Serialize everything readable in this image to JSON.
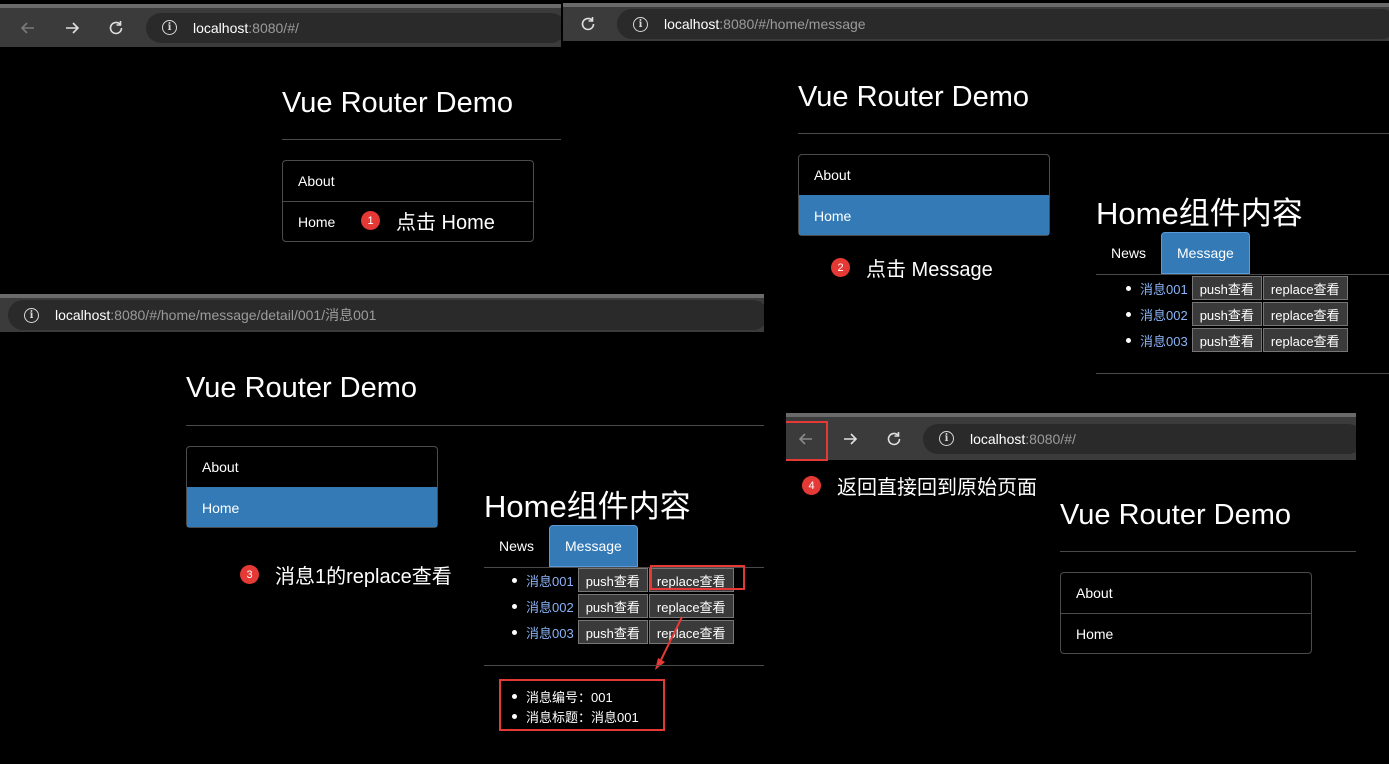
{
  "panel1": {
    "url_host": "localhost",
    "url_path": ":8080/#/",
    "title": "Vue Router Demo",
    "nav": [
      "About",
      "Home"
    ],
    "step_num": "1",
    "step_text": "点击 Home"
  },
  "panel2": {
    "url_host": "localhost",
    "url_path": ":8080/#/home/message",
    "title": "Vue Router Demo",
    "nav": [
      "About",
      "Home"
    ],
    "active_nav": "Home",
    "step_num": "2",
    "step_text": "点击 Message",
    "home_heading": "Home组件内容",
    "tabs": [
      "News",
      "Message"
    ],
    "active_tab": "Message",
    "messages": [
      {
        "title": "消息001",
        "push": "push查看",
        "replace": "replace查看"
      },
      {
        "title": "消息002",
        "push": "push查看",
        "replace": "replace查看"
      },
      {
        "title": "消息003",
        "push": "push查看",
        "replace": "replace查看"
      }
    ]
  },
  "panel3": {
    "url_host": "localhost",
    "url_path": ":8080/#/home/message/detail/001/消息001",
    "title": "Vue Router Demo",
    "nav": [
      "About",
      "Home"
    ],
    "active_nav": "Home",
    "step_num": "3",
    "step_text": "消息1的replace查看",
    "home_heading": "Home组件内容",
    "tabs": [
      "News",
      "Message"
    ],
    "active_tab": "Message",
    "messages": [
      {
        "title": "消息001",
        "push": "push查看",
        "replace": "replace查看"
      },
      {
        "title": "消息002",
        "push": "push查看",
        "replace": "replace查看"
      },
      {
        "title": "消息003",
        "push": "push查看",
        "replace": "replace查看"
      }
    ],
    "detail": [
      "消息编号：001",
      "消息标题：消息001"
    ]
  },
  "panel4": {
    "url_host": "localhost",
    "url_path": ":8080/#/",
    "step_num": "4",
    "step_text": "返回直接回到原始页面",
    "title": "Vue Router Demo",
    "nav": [
      "About",
      "Home"
    ]
  },
  "colors": {
    "active_blue": "#337ab7",
    "highlight_red": "#e53935",
    "link_blue": "#8ab4f8"
  },
  "icons": [
    "back-arrow-icon",
    "forward-arrow-icon",
    "reload-icon",
    "info-icon"
  ]
}
